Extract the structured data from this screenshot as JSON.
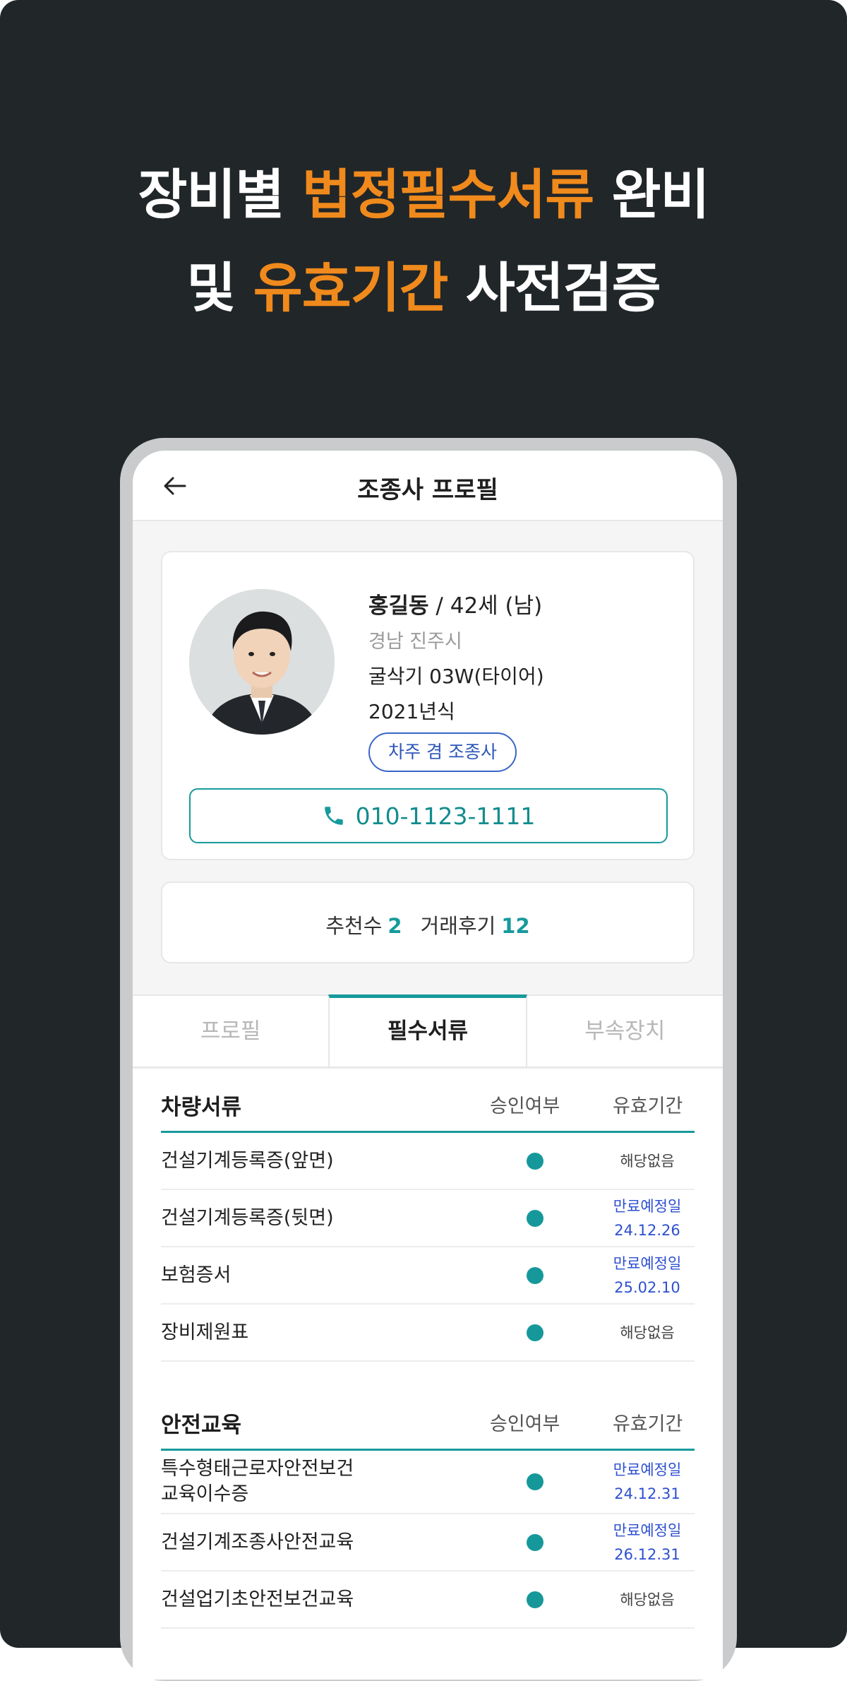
{
  "headline": {
    "line1_pre": "장비별 ",
    "line1_highlight": "법정필수서류",
    "line1_post": " 완비",
    "line2_pre": "및 ",
    "line2_highlight": "유효기간",
    "line2_post": " 사전검증"
  },
  "appbar": {
    "title": "조종사 프로필",
    "back_icon": "arrow-left-icon"
  },
  "profile": {
    "name": "홍길동",
    "age_gender": " / 42세 (남)",
    "region": "경남 진주시",
    "equipment": "굴삭기 03W(타이어)",
    "year": "2021년식",
    "role_badge": "차주 겸 조종사",
    "phone": "010-1123-1111",
    "phone_icon": "phone-icon"
  },
  "stats": {
    "recommend_label": "추천수",
    "recommend_count": "2",
    "reviews_label": "거래후기",
    "reviews_count": "12"
  },
  "tabs": [
    {
      "label": "프로필",
      "active": false
    },
    {
      "label": "필수서류",
      "active": true
    },
    {
      "label": "부속장치",
      "active": false
    }
  ],
  "columns": {
    "approve": "승인여부",
    "valid": "유효기간"
  },
  "vehicle_docs": {
    "title": "차량서류",
    "rows": [
      {
        "label": "건설기계등록증(앞면)",
        "validity_line1": "해당없음",
        "validity_line2": ""
      },
      {
        "label": "건설기계등록증(뒷면)",
        "validity_line1": "만료예정일",
        "validity_line2": "24.12.26"
      },
      {
        "label": "보험증서",
        "validity_line1": "만료예정일",
        "validity_line2": "25.02.10"
      },
      {
        "label": "장비제원표",
        "validity_line1": "해당없음",
        "validity_line2": ""
      }
    ]
  },
  "safety_docs": {
    "title": "안전교육",
    "rows": [
      {
        "label_line1": "특수형태근로자안전보건",
        "label_line2": "교육이수증",
        "validity_line1": "만료예정일",
        "validity_line2": "24.12.31"
      },
      {
        "label_line1": "건설기계조종사안전교육",
        "label_line2": "",
        "validity_line1": "만료예정일",
        "validity_line2": "26.12.31"
      },
      {
        "label_line1": "건설업기초안전보건교육",
        "label_line2": "",
        "validity_line1": "해당없음",
        "validity_line2": ""
      }
    ]
  },
  "colors": {
    "accent_orange": "#f08a1c",
    "teal": "#179a9c",
    "due_blue": "#2d4fd0",
    "background": "#212629"
  }
}
